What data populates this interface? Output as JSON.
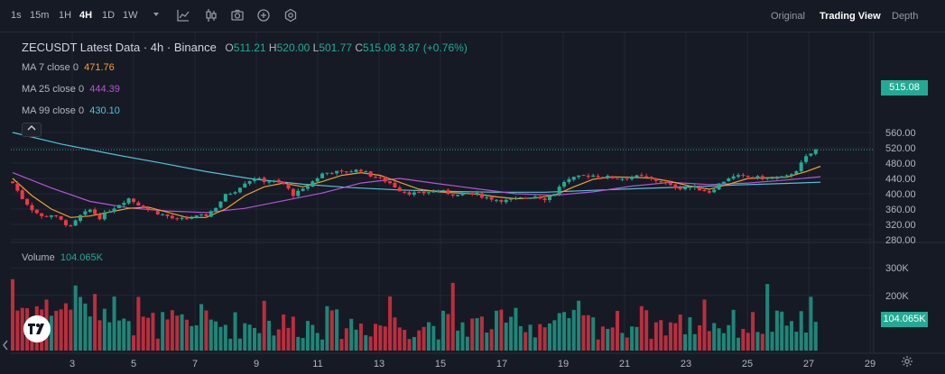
{
  "toolbar": {
    "timeframes": [
      {
        "label": "1s",
        "active": false
      },
      {
        "label": "15m",
        "active": false
      },
      {
        "label": "1H",
        "active": false
      },
      {
        "label": "4H",
        "active": true
      },
      {
        "label": "1D",
        "active": false
      },
      {
        "label": "1W",
        "active": false
      }
    ],
    "icons": [
      "chevron-down-icon",
      "indicators-icon",
      "candle-type-icon",
      "camera-icon",
      "add-icon",
      "settings-icon"
    ],
    "views": [
      {
        "label": "Original",
        "active": false
      },
      {
        "label": "Trading View",
        "active": true
      },
      {
        "label": "Depth",
        "active": false
      }
    ]
  },
  "legend": {
    "symbol": "ZECUSDT Latest Data · 4h · Binance",
    "open_label": "O",
    "open": "511.21",
    "high_label": "H",
    "high": "520.00",
    "low_label": "L",
    "low": "501.77",
    "close_label": "C",
    "close": "515.08",
    "change": "3.87 (+0.76%)",
    "ma7": {
      "label": "MA 7 close 0",
      "value": "471.76",
      "color": "#f0a030"
    },
    "ma25": {
      "label": "MA 25 close 0",
      "value": "444.39",
      "color": "#b455d4"
    },
    "ma99": {
      "label": "MA 99 close 0",
      "value": "430.10",
      "color": "#4fc3d9"
    },
    "volume_label": "Volume",
    "volume_value": "104.065K"
  },
  "colors": {
    "up": "#22ab94",
    "down": "#f23645",
    "grid": "#232735",
    "axis_text": "#b2b5be"
  },
  "chart_data": {
    "type": "candlestick",
    "price_axis": {
      "ticks": [
        "560.00",
        "520.00",
        "480.00",
        "440.00",
        "400.00",
        "360.00",
        "320.00",
        "280.00"
      ],
      "last_price": "515.08"
    },
    "volume_axis": {
      "ticks": [
        "300K",
        "200K"
      ],
      "last_volume": "104.065K"
    },
    "x_ticks": [
      "3",
      "5",
      "7",
      "9",
      "11",
      "13",
      "15",
      "17",
      "19",
      "21",
      "23",
      "25",
      "27",
      "29"
    ],
    "close_path": [
      [
        0,
        428
      ],
      [
        2,
        388
      ],
      [
        4,
        360
      ],
      [
        6,
        340
      ],
      [
        8,
        345
      ],
      [
        10,
        330
      ],
      [
        12,
        313
      ],
      [
        14,
        342
      ],
      [
        16,
        358
      ],
      [
        18,
        338
      ],
      [
        20,
        356
      ],
      [
        22,
        373
      ],
      [
        24,
        388
      ],
      [
        26,
        372
      ],
      [
        28,
        360
      ],
      [
        30,
        350
      ],
      [
        32,
        341
      ],
      [
        34,
        331
      ],
      [
        36,
        336
      ],
      [
        38,
        340
      ],
      [
        40,
        344
      ],
      [
        42,
        365
      ],
      [
        44,
        396
      ],
      [
        46,
        408
      ],
      [
        48,
        430
      ],
      [
        50,
        440
      ],
      [
        52,
        434
      ],
      [
        54,
        432
      ],
      [
        56,
        425
      ],
      [
        58,
        398
      ],
      [
        60,
        410
      ],
      [
        62,
        432
      ],
      [
        64,
        452
      ],
      [
        66,
        458
      ],
      [
        68,
        455
      ],
      [
        70,
        460
      ],
      [
        72,
        462
      ],
      [
        74,
        448
      ],
      [
        76,
        440
      ],
      [
        78,
        428
      ],
      [
        80,
        410
      ],
      [
        82,
        402
      ],
      [
        84,
        400
      ],
      [
        86,
        405
      ],
      [
        88,
        408
      ],
      [
        90,
        402
      ],
      [
        92,
        396
      ],
      [
        94,
        401
      ],
      [
        96,
        398
      ],
      [
        98,
        390
      ],
      [
        100,
        385
      ],
      [
        102,
        382
      ],
      [
        104,
        386
      ],
      [
        106,
        390
      ],
      [
        108,
        394
      ],
      [
        110,
        387
      ],
      [
        112,
        402
      ],
      [
        114,
        432
      ],
      [
        116,
        440
      ],
      [
        118,
        447
      ],
      [
        120,
        448
      ],
      [
        122,
        445
      ],
      [
        124,
        442
      ],
      [
        126,
        440
      ],
      [
        128,
        445
      ],
      [
        130,
        444
      ],
      [
        132,
        438
      ],
      [
        134,
        432
      ],
      [
        136,
        420
      ],
      [
        138,
        415
      ],
      [
        140,
        418
      ],
      [
        142,
        412
      ],
      [
        144,
        405
      ],
      [
        146,
        425
      ],
      [
        148,
        442
      ],
      [
        150,
        445
      ],
      [
        152,
        444
      ],
      [
        154,
        442
      ],
      [
        156,
        440
      ],
      [
        158,
        440
      ],
      [
        160,
        445
      ],
      [
        162,
        462
      ],
      [
        164,
        495
      ],
      [
        166,
        515
      ]
    ],
    "ma7_path": [
      [
        0,
        440
      ],
      [
        4,
        395
      ],
      [
        8,
        360
      ],
      [
        12,
        338
      ],
      [
        16,
        342
      ],
      [
        20,
        352
      ],
      [
        24,
        362
      ],
      [
        28,
        365
      ],
      [
        32,
        352
      ],
      [
        36,
        338
      ],
      [
        40,
        338
      ],
      [
        44,
        360
      ],
      [
        48,
        395
      ],
      [
        52,
        418
      ],
      [
        56,
        428
      ],
      [
        60,
        418
      ],
      [
        64,
        432
      ],
      [
        68,
        448
      ],
      [
        72,
        455
      ],
      [
        76,
        448
      ],
      [
        80,
        430
      ],
      [
        84,
        412
      ],
      [
        88,
        405
      ],
      [
        92,
        402
      ],
      [
        96,
        399
      ],
      [
        100,
        392
      ],
      [
        104,
        387
      ],
      [
        108,
        389
      ],
      [
        112,
        396
      ],
      [
        116,
        418
      ],
      [
        120,
        438
      ],
      [
        124,
        444
      ],
      [
        128,
        443
      ],
      [
        132,
        441
      ],
      [
        136,
        432
      ],
      [
        140,
        420
      ],
      [
        144,
        412
      ],
      [
        148,
        425
      ],
      [
        152,
        440
      ],
      [
        156,
        442
      ],
      [
        160,
        443
      ],
      [
        164,
        458
      ],
      [
        167,
        471.76
      ]
    ],
    "ma25_path": [
      [
        0,
        455
      ],
      [
        8,
        415
      ],
      [
        16,
        380
      ],
      [
        24,
        363
      ],
      [
        32,
        355
      ],
      [
        40,
        351
      ],
      [
        48,
        362
      ],
      [
        56,
        382
      ],
      [
        64,
        402
      ],
      [
        72,
        428
      ],
      [
        80,
        440
      ],
      [
        88,
        426
      ],
      [
        96,
        413
      ],
      [
        104,
        400
      ],
      [
        112,
        396
      ],
      [
        120,
        405
      ],
      [
        128,
        420
      ],
      [
        136,
        430
      ],
      [
        144,
        424
      ],
      [
        152,
        428
      ],
      [
        160,
        436
      ],
      [
        167,
        444.39
      ]
    ],
    "ma99_path": [
      [
        0,
        560
      ],
      [
        10,
        530
      ],
      [
        20,
        505
      ],
      [
        30,
        482
      ],
      [
        40,
        458
      ],
      [
        50,
        438
      ],
      [
        60,
        425
      ],
      [
        70,
        416
      ],
      [
        80,
        410
      ],
      [
        90,
        406
      ],
      [
        100,
        404
      ],
      [
        110,
        404
      ],
      [
        120,
        409
      ],
      [
        130,
        414
      ],
      [
        140,
        418
      ],
      [
        150,
        423
      ],
      [
        160,
        427
      ],
      [
        167,
        430.1
      ]
    ]
  }
}
